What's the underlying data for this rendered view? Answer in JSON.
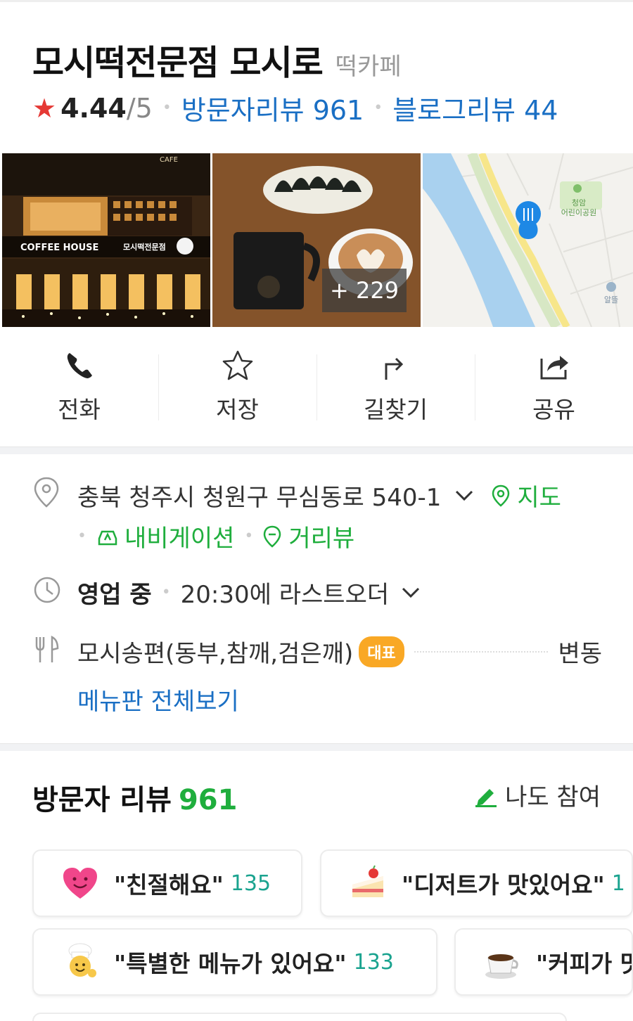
{
  "place": {
    "name": "모시떡전문점 모시로",
    "category": "떡카페",
    "rating": "4.44",
    "rating_max": "/5",
    "visitor_reviews_link": "방문자리뷰 961",
    "blog_reviews_link": "블로그리뷰 44"
  },
  "photos": {
    "storefront_sign_cafe": "CAFE",
    "storefront_sign_coffee": "COFFEE HOUSE",
    "storefront_sign_name": "모시떡전문점",
    "more_count": "+ 229",
    "map_park_label": "청암\n어린이공원",
    "map_poi_label": "알뜰"
  },
  "actions": [
    {
      "label": "전화",
      "icon": "phone-icon"
    },
    {
      "label": "저장",
      "icon": "star-icon"
    },
    {
      "label": "길찾기",
      "icon": "directions-icon"
    },
    {
      "label": "공유",
      "icon": "share-icon"
    }
  ],
  "info": {
    "address": "충북 청주시 청원구 무심동로 540-1",
    "map_link": "지도",
    "navigation_link": "내비게이션",
    "street_view_link": "거리뷰",
    "status": "영업 중",
    "last_order": "20:30에 라스트오더",
    "menu_item": "모시송편(동부,참깨,검은깨)",
    "menu_badge": "대표",
    "menu_price": "변동",
    "menu_board_link": "메뉴판 전체보기"
  },
  "reviews": {
    "title": "방문자 리뷰",
    "count": "961",
    "join_label": "나도 참여",
    "keywords": [
      {
        "text": "\"친절해요\"",
        "count": "135",
        "icon": "heart-emoji-icon"
      },
      {
        "text": "\"디저트가 맛있어요\"",
        "count": "1",
        "icon": "cake-emoji-icon"
      },
      {
        "text": "\"특별한 메뉴가 있어요\"",
        "count": "133",
        "icon": "chef-emoji-icon"
      },
      {
        "text": "\"커피가 맛",
        "count": "",
        "icon": "coffee-emoji-icon"
      }
    ]
  },
  "colors": {
    "accent_blue": "#1a6fc4",
    "accent_green": "#1fae3d",
    "rating_star": "#e53935",
    "badge_orange": "#f9a825"
  }
}
